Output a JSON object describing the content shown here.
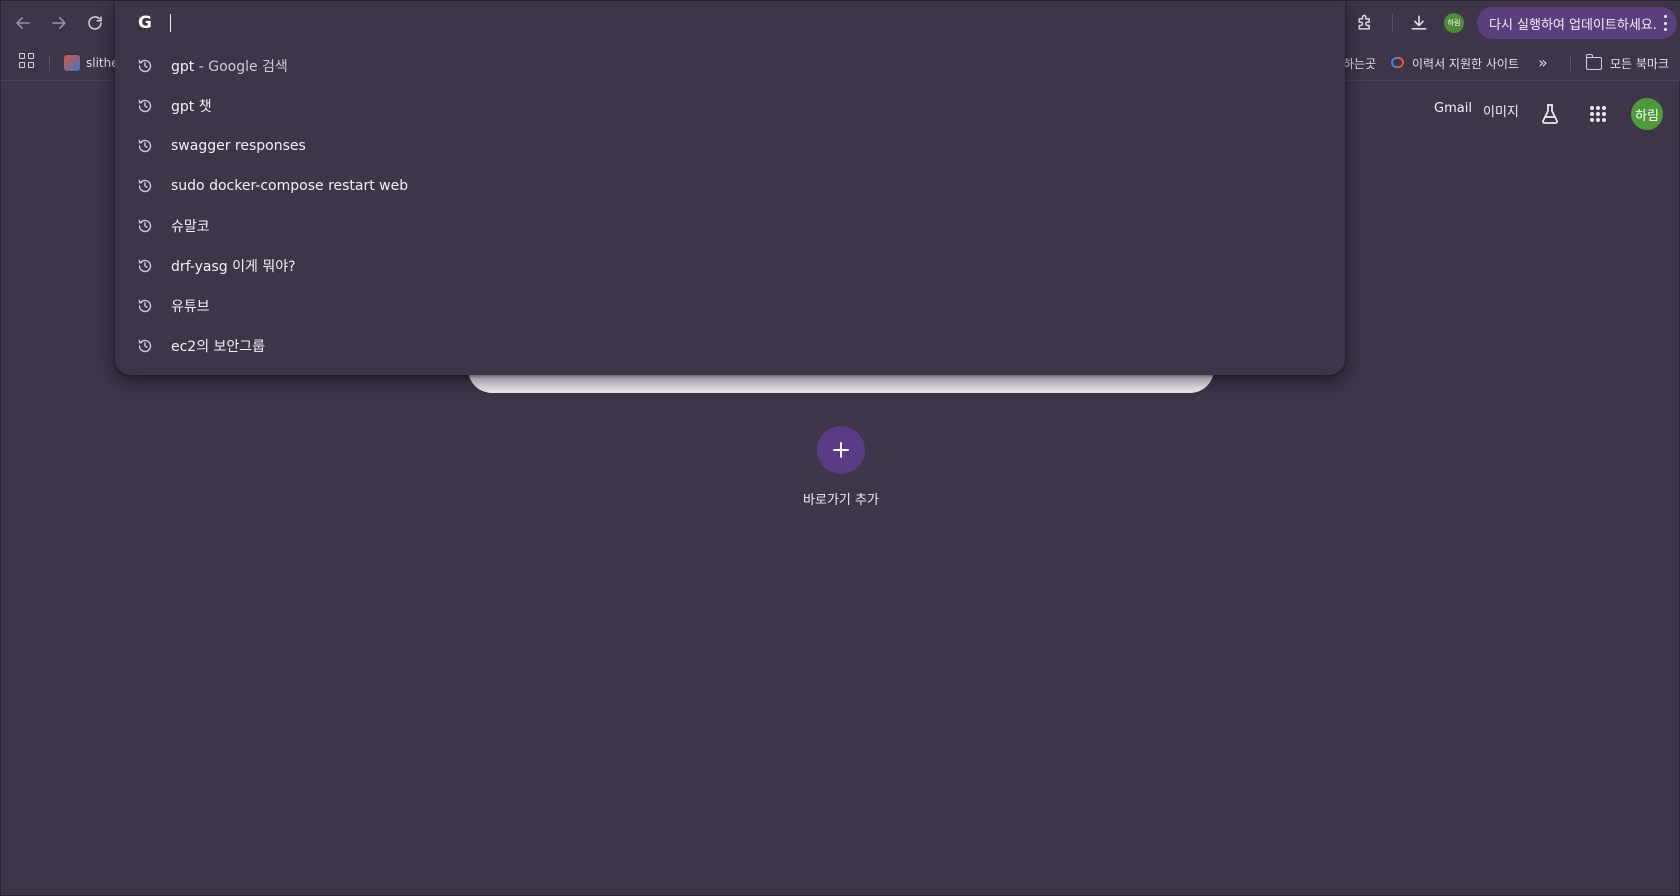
{
  "toolbar": {
    "profile_initials": "하림",
    "update_label": "다시 실행하여 업데이트하세요."
  },
  "bookmarks": {
    "items": [
      {
        "label": "slithe",
        "icon": "slither-favicon"
      },
      {
        "label": "하는곳",
        "icon": ""
      },
      {
        "label": "이력서 지원한 사이트",
        "icon": "resume-favicon"
      }
    ],
    "overflow": "»",
    "all_bookmarks_label": "모든 북마크"
  },
  "omnibox": {
    "engine_icon": "G",
    "input_value": "",
    "suggestions": [
      {
        "text": "gpt",
        "suffix": " - Google 검색"
      },
      {
        "text": "gpt 챗",
        "suffix": ""
      },
      {
        "text": "swagger responses",
        "suffix": ""
      },
      {
        "text": "sudo docker-compose restart web",
        "suffix": ""
      },
      {
        "text": "슈말코",
        "suffix": ""
      },
      {
        "text": "drf-yasg 이게 뭐야?",
        "suffix": ""
      },
      {
        "text": "유튜브",
        "suffix": ""
      },
      {
        "text": "ec2의 보안그룹",
        "suffix": ""
      }
    ]
  },
  "ntp": {
    "links": {
      "gmail": "Gmail",
      "images": "이미지"
    },
    "account_initials": "하림",
    "add_shortcut_label": "바로가기 추가"
  },
  "colors": {
    "background": "#3e3549",
    "update_chip": "#5a3f7d",
    "add_shortcut": "#5b3a86",
    "avatar": "#4f9a3b"
  }
}
